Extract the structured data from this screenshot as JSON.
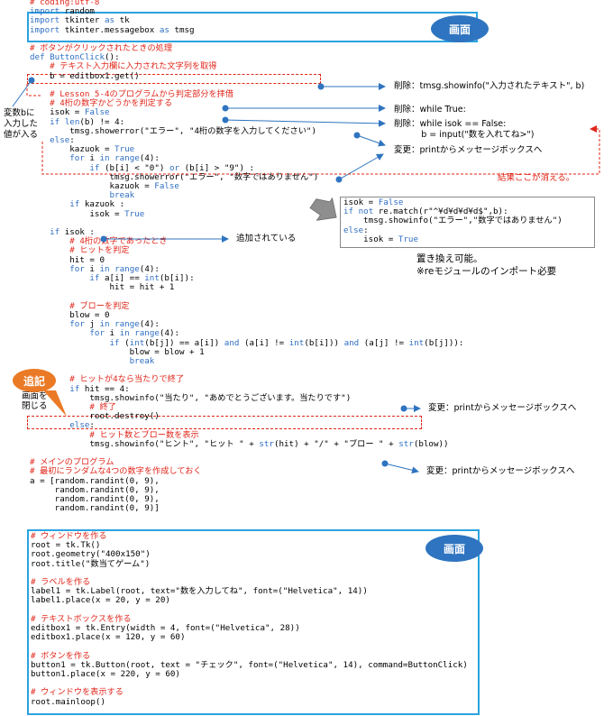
{
  "labels": {
    "screen_top": "画面",
    "screen_bottom": "画面",
    "addition": "追記"
  },
  "notes": {
    "var_b_input": "変数bに\n入力した\n値が入る",
    "delete_showinfo": "削除：tmsg.showinfo(\"入力されたテキスト\", b)",
    "delete_while_true": "削除：while True:",
    "delete_while_isok": "削除：while isok == False:\n          b = input(\"数を入れてね>\")",
    "change_msgbox_1": "変更：printからメッセージボックスへ",
    "result_gone": "結果ここが消える。",
    "added": "追加されている",
    "replaceable": "置き換え可能。\n※reモジュールのインポート必要",
    "change_msgbox_2": "変更：printからメッセージボックスへ",
    "change_msgbox_3": "変更：printからメッセージボックスへ",
    "close_screen": "画面を\n閉じる"
  },
  "code": {
    "l01": "# coding:utf-8",
    "l02a": "import",
    "l02b": " random",
    "l03a": "import",
    "l03b": " tkinter ",
    "l03c": "as",
    "l03d": " tk",
    "l04a": "import",
    "l04b": " tkinter.messagebox ",
    "l04c": "as",
    "l04d": " tmsg",
    "l06": "# ボタンがクリックされたときの処理",
    "l07a": "def",
    "l07b": " ButtonClick",
    "l07c": "():",
    "l08": "    # テキスト入力欄に入力された文字列を取得",
    "l09": "    b = editbox1.get()",
    "l11": "    # Lesson 5-4のプログラムから判定部分を拝借",
    "l12": "    # 4桁の数字かどうかを判定する",
    "l13a": "    isok = ",
    "l13b": "False",
    "l14a": "    ",
    "l14b": "if",
    "l14c": " ",
    "l14d": "len",
    "l14e": "(b) != 4:",
    "l15a": "        tmsg.showerror(",
    "l15b": "\"エラー\"",
    "l15c": ", ",
    "l15d": "\"4桁の数字を入力してください\"",
    "l15e": ")",
    "l16a": "    ",
    "l16b": "else",
    "l16c": ":",
    "l17a": "        kazuok = ",
    "l17b": "True",
    "l18a": "        ",
    "l18b": "for",
    "l18c": " i ",
    "l18d": "in",
    "l18e": " ",
    "l18f": "range",
    "l18g": "(4):",
    "l19a": "            ",
    "l19b": "if",
    "l19c": " (b[i] < ",
    "l19d": "\"0\"",
    "l19e": ") ",
    "l19f": "or",
    "l19g": " (b[i] > ",
    "l19h": "\"9\"",
    "l19i": ") :",
    "l20a": "                tmsg.showerror(",
    "l20b": "\"エラー\"",
    "l20c": ", ",
    "l20d": "\"数字ではありません\"",
    "l20e": ")",
    "l21a": "                kazuok = ",
    "l21b": "False",
    "l22a": "                ",
    "l22b": "break",
    "l23a": "        ",
    "l23b": "if",
    "l23c": " kazuok :",
    "l24a": "            isok = ",
    "l24b": "True",
    "l26a": "    ",
    "l26b": "if",
    "l26c": " isok :",
    "l27": "        # 4桁の数字であったとき",
    "l28": "        # ヒットを判定",
    "l29": "        hit = 0",
    "l30a": "        ",
    "l30b": "for",
    "l30c": " i ",
    "l30d": "in",
    "l30e": " ",
    "l30f": "range",
    "l30g": "(4):",
    "l31a": "            ",
    "l31b": "if",
    "l31c": " a[i] == ",
    "l31d": "int",
    "l31e": "(b[i]):",
    "l32": "                hit = hit + 1",
    "l34": "        # ブローを判定",
    "l35": "        blow = 0",
    "l36a": "        ",
    "l36b": "for",
    "l36c": " j ",
    "l36d": "in",
    "l36e": " ",
    "l36f": "range",
    "l36g": "(4):",
    "l37a": "            ",
    "l37b": "for",
    "l37c": " i ",
    "l37d": "in",
    "l37e": " ",
    "l37f": "range",
    "l37g": "(4):",
    "l38a": "                ",
    "l38b": "if",
    "l38c": " (",
    "l38d": "int",
    "l38e": "(b[j]) == a[i]) ",
    "l38f": "and",
    "l38g": " (a[i] != ",
    "l38h": "int",
    "l38i": "(b[i])) ",
    "l38j": "and",
    "l38k": " (a[j] != ",
    "l38l": "int",
    "l38m": "(b[j])):",
    "l39": "                    blow = blow + 1",
    "l40a": "                    ",
    "l40b": "break",
    "l42": "        # ヒットが4なら当たりで終了",
    "l43a": "        ",
    "l43b": "if",
    "l43c": " hit == 4:",
    "l44a": "            tmsg.showinfo(",
    "l44b": "\"当たり\"",
    "l44c": ", ",
    "l44d": "\"あめでとうございます。当たりです\"",
    "l44e": ")",
    "l45": "            # 終了",
    "l46": "            root.destroy()",
    "l47a": "        ",
    "l47b": "else",
    "l47c": ":",
    "l48": "            # ヒット数とブロー数を表示",
    "l49a": "            tmsg.showinfo(",
    "l49b": "\"ヒント\"",
    "l49c": ", ",
    "l49d": "\"ヒット \"",
    "l49e": " + ",
    "l49f": "str",
    "l49g": "(hit) + ",
    "l49h": "\"/\"",
    "l49i": " + ",
    "l49j": "\"ブロー \"",
    "l49k": " + ",
    "l49l": "str",
    "l49m": "(blow))",
    "l51": "# メインのプログラム",
    "l52": "# 最初にランダムな4つの数字を作成しておく",
    "l53": "a = [random.randint(0, 9),",
    "l54": "     random.randint(0, 9),",
    "l55": "     random.randint(0, 9),",
    "l56": "     random.randint(0, 9)]"
  },
  "replacement_code": {
    "r1a": "isok = ",
    "r1b": "False",
    "r2a": "if",
    "r2b": " ",
    "r2c": "not",
    "r2d": " re.match(",
    "r2e": "r\"^¥d¥d¥d¥d$\"",
    "r2f": ",b):",
    "r3a": "    tmsg.showinfo(",
    "r3b": "\"エラー\"",
    "r3c": ",",
    "r3d": "\"数字ではありません\"",
    "r3e": ")",
    "r4a": "else",
    "r4b": ":",
    "r5a": "    isok = ",
    "r5b": "True"
  },
  "window_code": {
    "w01": "# ウィンドウを作る",
    "w02": "root = tk.Tk()",
    "w03a": "root.geometry(",
    "w03b": "\"400x150\"",
    "w03c": ")",
    "w04a": "root.title(",
    "w04b": "\"数当てゲーム\"",
    "w04c": ")",
    "w06": "# ラベルを作る",
    "w07a": "label1 = tk.Label(root, text=",
    "w07b": "\"数を入力してね\"",
    "w07c": ", font=(",
    "w07d": "\"Helvetica\"",
    "w07e": ", 14))",
    "w08": "label1.place(x = 20, y = 20)",
    "w10": "# テキストボックスを作る",
    "w11a": "editbox1 = tk.Entry(width = 4, font=(",
    "w11b": "\"Helvetica\"",
    "w11c": ", 28))",
    "w12": "editbox1.place(x = 120, y = 60)",
    "w14": "# ボタンを作る",
    "w15a": "button1 = tk.Button(root, text = ",
    "w15b": "\"チェック\"",
    "w15c": ", font=(",
    "w15d": "\"Helvetica\"",
    "w15e": ", 14), command=ButtonClick)",
    "w16": "button1.place(x = 220, y = 60)",
    "w18": "# ウィンドウを表示する",
    "w19": "root.mainloop()"
  },
  "colors": {
    "comment": "#e0261a",
    "keyword": "#2f6fc2",
    "string": "#000000",
    "screen_badge": "#2f74c0",
    "addition_badge": "#ea7a26",
    "frame": "#2aa3e0"
  }
}
